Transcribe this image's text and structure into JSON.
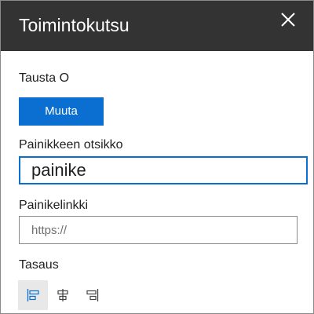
{
  "panel": {
    "title": "Toimintokutsu",
    "close_icon": "close-icon"
  },
  "background": {
    "label": "Tausta O",
    "change_button": "Muuta",
    "button_color": "#0a6fd0"
  },
  "button_text": {
    "label": "Painikkeen otsikko",
    "value": "painike"
  },
  "button_link": {
    "label": "Painikelinkki",
    "placeholder": "https://"
  },
  "alignment": {
    "label": "Tasaus",
    "options": [
      {
        "icon": "align-left-icon",
        "selected": true
      },
      {
        "icon": "align-center-icon",
        "selected": false
      },
      {
        "icon": "align-right-icon",
        "selected": false
      }
    ]
  }
}
